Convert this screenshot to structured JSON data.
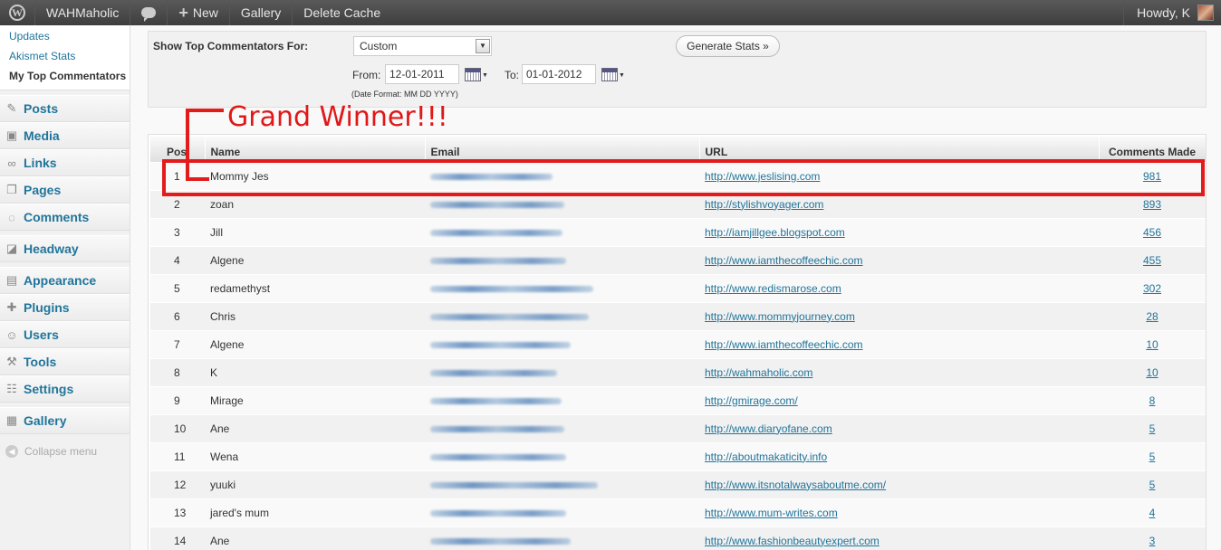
{
  "adminbar": {
    "site_name": "WAHMaholic",
    "new_label": "New",
    "gallery_label": "Gallery",
    "delete_cache_label": "Delete Cache",
    "howdy": "Howdy, K"
  },
  "sidebar": {
    "submenu": [
      "Updates",
      "Akismet Stats",
      "My Top Commentators"
    ],
    "groups": [
      [
        {
          "label": "Posts",
          "icon": "pushpin-icon"
        },
        {
          "label": "Media",
          "icon": "media-icon"
        },
        {
          "label": "Links",
          "icon": "link-icon"
        },
        {
          "label": "Pages",
          "icon": "pages-icon"
        },
        {
          "label": "Comments",
          "icon": "comment-icon"
        }
      ],
      [
        {
          "label": "Headway",
          "icon": "headway-icon"
        }
      ],
      [
        {
          "label": "Appearance",
          "icon": "appearance-icon"
        },
        {
          "label": "Plugins",
          "icon": "plugin-icon"
        },
        {
          "label": "Users",
          "icon": "users-icon"
        },
        {
          "label": "Tools",
          "icon": "tools-icon"
        },
        {
          "label": "Settings",
          "icon": "settings-icon"
        }
      ],
      [
        {
          "label": "Gallery",
          "icon": "gallery-icon"
        }
      ]
    ],
    "collapse_label": "Collapse menu"
  },
  "form": {
    "show_label": "Show Top Commentators For:",
    "period_value": "Custom",
    "generate_label": "Generate Stats »",
    "from_label": "From:",
    "from_value": "12-01-2011",
    "to_label": "To:",
    "to_value": "01-01-2012",
    "date_format": "(Date Format: MM DD YYYY)"
  },
  "annotation": {
    "text": "Grand Winner!!!",
    "color": "#e21b1b"
  },
  "table": {
    "headers": [
      "Pos",
      "Name",
      "Email",
      "URL",
      "Comments Made"
    ],
    "rows": [
      {
        "pos": "1",
        "name": "Mommy Jes",
        "url": "http://www.jeslising.com",
        "comments": "981"
      },
      {
        "pos": "2",
        "name": "zoan",
        "url": "http://stylishvoyager.com",
        "comments": "893"
      },
      {
        "pos": "3",
        "name": "Jill",
        "url": "http://iamjillgee.blogspot.com",
        "comments": "456"
      },
      {
        "pos": "4",
        "name": "Algene",
        "url": "http://www.iamthecoffeechic.com",
        "comments": "455"
      },
      {
        "pos": "5",
        "name": "redamethyst",
        "url": "http://www.redismarose.com",
        "comments": "302"
      },
      {
        "pos": "6",
        "name": "Chris",
        "url": "http://www.mommyjourney.com",
        "comments": "28"
      },
      {
        "pos": "7",
        "name": "Algene",
        "url": "http://www.iamthecoffeechic.com",
        "comments": "10"
      },
      {
        "pos": "8",
        "name": "K",
        "url": "http://wahmaholic.com",
        "comments": "10"
      },
      {
        "pos": "9",
        "name": "Mirage",
        "url": "http://gmirage.com/",
        "comments": "8"
      },
      {
        "pos": "10",
        "name": "Ane",
        "url": "http://www.diaryofane.com",
        "comments": "5"
      },
      {
        "pos": "11",
        "name": "Wena",
        "url": "http://aboutmakaticity.info",
        "comments": "5"
      },
      {
        "pos": "12",
        "name": "yuuki",
        "url": "http://www.itsnotalwaysaboutme.com/",
        "comments": "5"
      },
      {
        "pos": "13",
        "name": "jared's mum",
        "url": "http://www.mum-writes.com",
        "comments": "4"
      },
      {
        "pos": "14",
        "name": "Ane",
        "url": "http://www.fashionbeautyexpert.com",
        "comments": "3"
      }
    ]
  }
}
